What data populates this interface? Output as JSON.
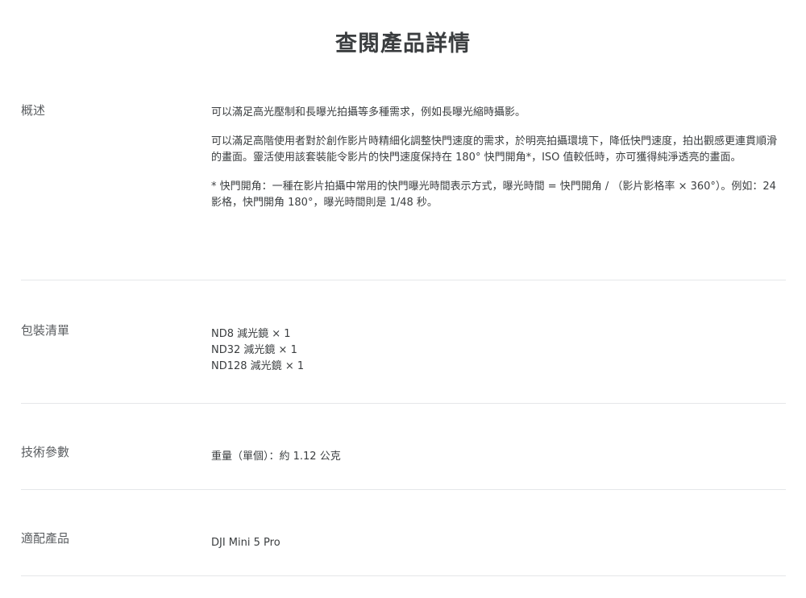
{
  "page": {
    "title": "查閱產品詳情"
  },
  "sections": {
    "overview": {
      "label": "概述",
      "paragraphs": [
        "可以滿足高光壓制和長曝光拍攝等多種需求，例如長曝光縮時攝影。",
        "可以滿足高階使用者對於創作影片時精細化調整快門速度的需求，於明亮拍攝環境下，降低快門速度，拍出觀感更連貫順滑的畫面。靈活使用該套裝能令影片的快門速度保持在 180° 快門開角*，ISO 值較低時，亦可獲得純淨透亮的畫面。",
        "* 快門開角：一種在影片拍攝中常用的快門曝光時間表示方式，曝光時間 = 快門開角 / （影片影格率 × 360°）。例如：24 影格，快門開角 180°，曝光時間則是 1/48 秒。"
      ]
    },
    "package": {
      "label": "包裝清單",
      "items": [
        "ND8 減光鏡 × 1",
        "ND32 減光鏡 × 1",
        "ND128 減光鏡 × 1"
      ]
    },
    "specs": {
      "label": "技術參數",
      "weight": "重量（單個）：約 1.12 公克"
    },
    "compatibility": {
      "label": "適配產品",
      "product": "DJI Mini 5 Pro"
    }
  }
}
